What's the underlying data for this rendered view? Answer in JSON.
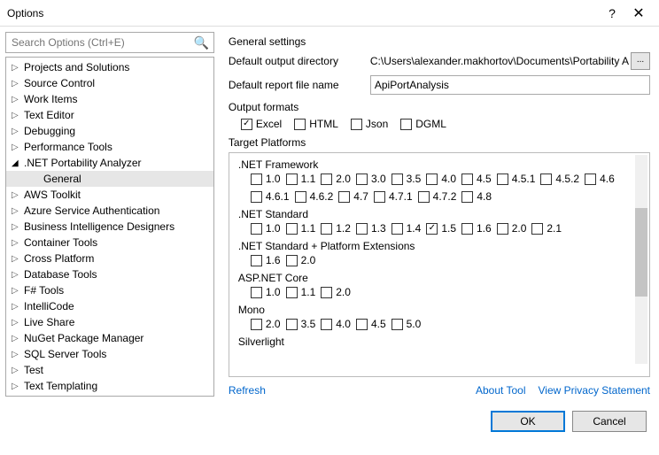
{
  "window": {
    "title": "Options",
    "help": "?",
    "close": "✕"
  },
  "search": {
    "placeholder": "Search Options (Ctrl+E)"
  },
  "tree": {
    "items": [
      {
        "label": "Projects and Solutions",
        "expanded": false
      },
      {
        "label": "Source Control",
        "expanded": false
      },
      {
        "label": "Work Items",
        "expanded": false
      },
      {
        "label": "Text Editor",
        "expanded": false
      },
      {
        "label": "Debugging",
        "expanded": false
      },
      {
        "label": "Performance Tools",
        "expanded": false
      },
      {
        "label": ".NET Portability Analyzer",
        "expanded": true,
        "children": [
          {
            "label": "General",
            "selected": true
          }
        ]
      },
      {
        "label": "AWS Toolkit",
        "expanded": false
      },
      {
        "label": "Azure Service Authentication",
        "expanded": false
      },
      {
        "label": "Business Intelligence Designers",
        "expanded": false
      },
      {
        "label": "Container Tools",
        "expanded": false
      },
      {
        "label": "Cross Platform",
        "expanded": false
      },
      {
        "label": "Database Tools",
        "expanded": false
      },
      {
        "label": "F# Tools",
        "expanded": false
      },
      {
        "label": "IntelliCode",
        "expanded": false
      },
      {
        "label": "Live Share",
        "expanded": false
      },
      {
        "label": "NuGet Package Manager",
        "expanded": false
      },
      {
        "label": "SQL Server Tools",
        "expanded": false
      },
      {
        "label": "Test",
        "expanded": false
      },
      {
        "label": "Text Templating",
        "expanded": false
      }
    ]
  },
  "general": {
    "heading": "General settings",
    "dir_label": "Default output directory",
    "dir_value": "C:\\Users\\alexander.makhortov\\Documents\\Portability A",
    "ellipsis": "...",
    "file_label": "Default report file name",
    "file_value": "ApiPortAnalysis"
  },
  "output_formats": {
    "heading": "Output formats",
    "items": [
      {
        "label": "Excel",
        "checked": true
      },
      {
        "label": "HTML",
        "checked": false
      },
      {
        "label": "Json",
        "checked": false
      },
      {
        "label": "DGML",
        "checked": false
      }
    ]
  },
  "target_platforms": {
    "heading": "Target Platforms",
    "groups": [
      {
        "title": ".NET Framework",
        "versions": [
          {
            "v": "1.0",
            "c": false
          },
          {
            "v": "1.1",
            "c": false
          },
          {
            "v": "2.0",
            "c": false
          },
          {
            "v": "3.0",
            "c": false
          },
          {
            "v": "3.5",
            "c": false
          },
          {
            "v": "4.0",
            "c": false
          },
          {
            "v": "4.5",
            "c": false
          },
          {
            "v": "4.5.1",
            "c": false
          },
          {
            "v": "4.5.2",
            "c": false
          },
          {
            "v": "4.6",
            "c": false
          },
          {
            "v": "4.6.1",
            "c": false
          },
          {
            "v": "4.6.2",
            "c": false
          },
          {
            "v": "4.7",
            "c": false
          },
          {
            "v": "4.7.1",
            "c": false
          },
          {
            "v": "4.7.2",
            "c": false
          },
          {
            "v": "4.8",
            "c": false
          }
        ]
      },
      {
        "title": ".NET Standard",
        "versions": [
          {
            "v": "1.0",
            "c": false
          },
          {
            "v": "1.1",
            "c": false
          },
          {
            "v": "1.2",
            "c": false
          },
          {
            "v": "1.3",
            "c": false
          },
          {
            "v": "1.4",
            "c": false
          },
          {
            "v": "1.5",
            "c": true
          },
          {
            "v": "1.6",
            "c": false
          },
          {
            "v": "2.0",
            "c": false
          },
          {
            "v": "2.1",
            "c": false
          }
        ]
      },
      {
        "title": ".NET Standard + Platform Extensions",
        "versions": [
          {
            "v": "1.6",
            "c": false
          },
          {
            "v": "2.0",
            "c": false
          }
        ]
      },
      {
        "title": "ASP.NET Core",
        "versions": [
          {
            "v": "1.0",
            "c": false
          },
          {
            "v": "1.1",
            "c": false
          },
          {
            "v": "2.0",
            "c": false
          }
        ]
      },
      {
        "title": "Mono",
        "versions": [
          {
            "v": "2.0",
            "c": false
          },
          {
            "v": "3.5",
            "c": false
          },
          {
            "v": "4.0",
            "c": false
          },
          {
            "v": "4.5",
            "c": false
          },
          {
            "v": "5.0",
            "c": false
          }
        ]
      },
      {
        "title": "Silverlight",
        "versions": []
      }
    ]
  },
  "links": {
    "refresh": "Refresh",
    "about": "About Tool",
    "privacy": "View Privacy Statement"
  },
  "buttons": {
    "ok": "OK",
    "cancel": "Cancel"
  }
}
